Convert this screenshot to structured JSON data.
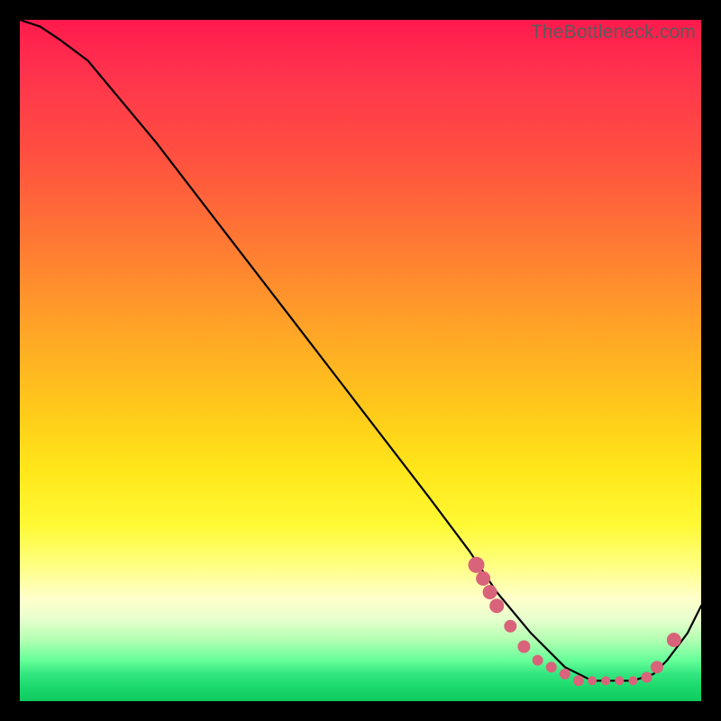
{
  "watermark": "TheBottleneck.com",
  "chart_data": {
    "type": "line",
    "title": "",
    "xlabel": "",
    "ylabel": "",
    "xlim": [
      0,
      100
    ],
    "ylim": [
      0,
      100
    ],
    "grid": false,
    "series": [
      {
        "name": "curve",
        "x": [
          0,
          3,
          6,
          10,
          20,
          30,
          40,
          50,
          60,
          66,
          70,
          75,
          80,
          84,
          88,
          90,
          93,
          95,
          98,
          100
        ],
        "values": [
          100,
          99,
          97,
          94,
          82,
          69,
          56,
          43,
          30,
          22,
          16,
          10,
          5,
          3,
          3,
          3,
          4,
          6,
          10,
          14
        ]
      }
    ],
    "markers": {
      "comment": "pink marker dots along the valley / right-upturn segment",
      "color": "#d9637a",
      "x": [
        67,
        68,
        69,
        70,
        72,
        74,
        76,
        78,
        80,
        82,
        84,
        86,
        88,
        90,
        92,
        93.5,
        96
      ],
      "values": [
        20,
        18,
        16,
        14,
        11,
        8,
        6,
        5,
        4,
        3,
        3,
        3,
        3,
        3,
        3.5,
        5,
        9
      ],
      "size": [
        9,
        8,
        8,
        8,
        7,
        7,
        6,
        6,
        6,
        6,
        5,
        5,
        5,
        5,
        6,
        7,
        8
      ]
    }
  }
}
